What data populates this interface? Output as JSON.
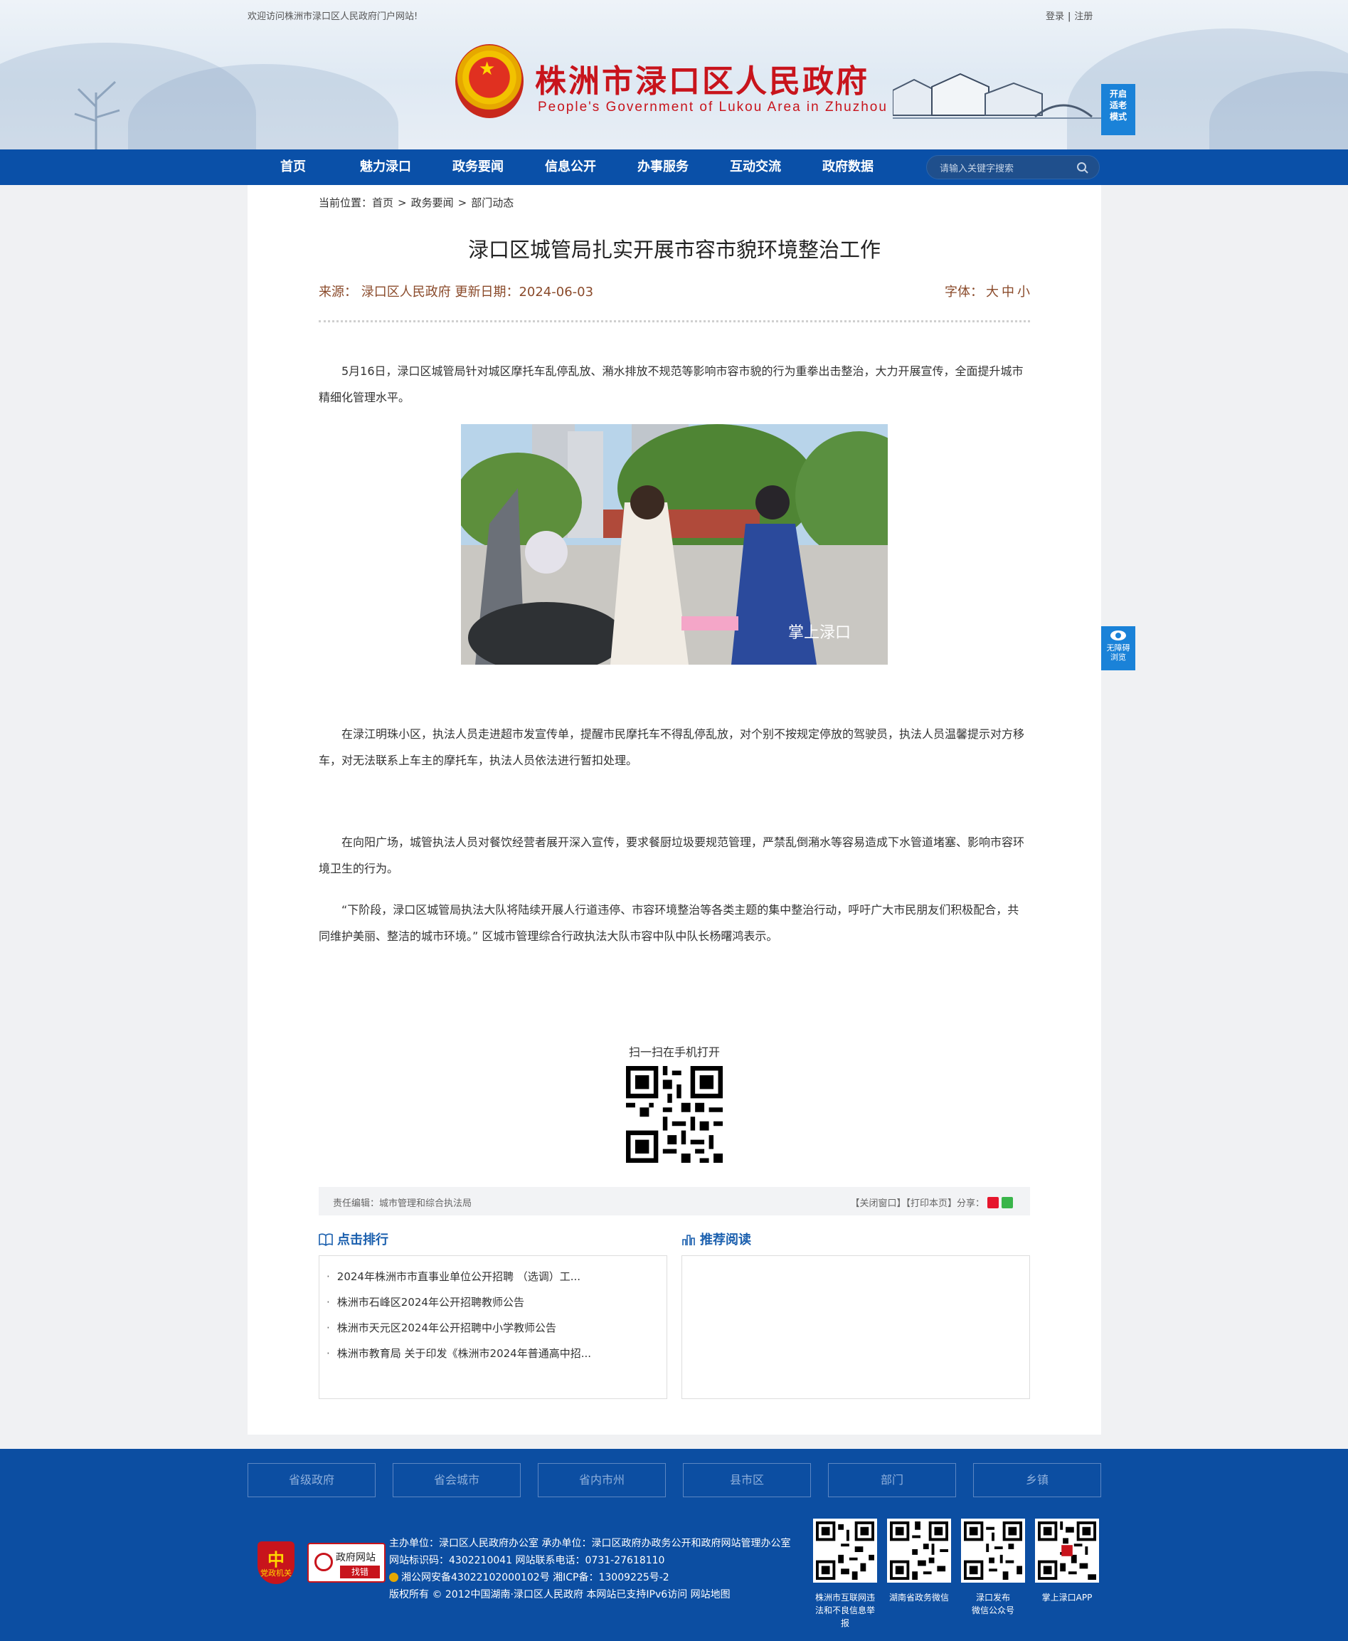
{
  "header": {
    "welcome": "欢迎访问株洲市渌口区人民政府门户网站!",
    "login": "登录",
    "separator": "|",
    "register": "注册",
    "site_title": "株洲市渌口区人民政府",
    "site_subtitle": "People's Government of Lukou Area in Zhuzhou",
    "elder_mode_lines": [
      "开启",
      "适老",
      "模式"
    ]
  },
  "nav": {
    "items": [
      "首页",
      "魅力渌口",
      "政务要闻",
      "信息公开",
      "办事服务",
      "互动交流",
      "政府数据"
    ],
    "search_placeholder": "请输入关键字搜索"
  },
  "breadcrumb": {
    "label": "当前位置：",
    "items": [
      "首页",
      "政务要闻",
      "部门动态"
    ],
    "sep": ">"
  },
  "article": {
    "title": "渌口区城管局扎实开展市容市貌环境整治工作",
    "meta": "来源：  渌口区人民政府 更新日期：2024-06-03",
    "font_label": "字体：",
    "font_sizes": [
      "大",
      "中",
      "小"
    ],
    "paragraphs": [
      "5月16日，渌口区城管局针对城区摩托车乱停乱放、潲水排放不规范等影响市容市貌的行为重拳出击整治，大力开展宣传，全面提升城市精细化管理水平。",
      "在渌江明珠小区，执法人员走进超市发宣传单，提醒市民摩托车不得乱停乱放，对个别不按规定停放的驾驶员，执法人员温馨提示对方移车，对无法联系上车主的摩托车，执法人员依法进行暂扣处理。",
      "在向阳广场，城管执法人员对餐饮经营者展开深入宣传，要求餐厨垃圾要规范管理，严禁乱倒潲水等容易造成下水管道堵塞、影响市容环境卫生的行为。",
      "“下阶段，渌口区城管局执法大队将陆续开展人行道违停、市容环境整治等各类主题的集中整治行动，呼吁广大市民朋友们积极配合，共同维护美丽、整洁的城市环境。” 区城市管理综合行政执法大队市容中队中队长杨曙鸿表示。"
    ],
    "photo_watermark": "掌上渌口",
    "qr_label": "扫一扫在手机打开"
  },
  "editor_bar": {
    "editor": "责任编辑：城市管理和综合执法局",
    "close": "【关闭窗口】",
    "print": "【打印本页】",
    "share": "分享："
  },
  "ranking": {
    "title": "点击排行",
    "items": [
      "2024年株洲市市直事业单位公开招聘 （选调）工...",
      "株洲市石峰区2024年公开招聘教师公告",
      "株洲市天元区2024年公开招聘中小学教师公告",
      "株洲市教育局 关于印发《株洲市2024年普通高中招..."
    ]
  },
  "recommend": {
    "title": "推荐阅读"
  },
  "footer": {
    "links": [
      "省级政府",
      "省会城市",
      "省内市州",
      "县市区",
      "部门",
      "乡镇"
    ],
    "badge_text": "党政机关",
    "jiucuo_line1": "政府网站",
    "jiucuo_line2": "找错",
    "info": [
      "主办单位：渌口区人民政府办公室  承办单位：渌口区政府办政务公开和政府网站管理办公室",
      "网站标识码：4302210041  网站联系电话：0731-27618110",
      "湘公网安备43022102000102号  湘ICP备：13009225号-2",
      "版权所有 © 2012中国湖南·渌口区人民政府 本网站已支持IPv6访问 网站地图"
    ],
    "qr_labels": [
      [
        "株洲市互联网违",
        "法和不良信息举",
        "报"
      ],
      [
        "湖南省政务微信"
      ],
      [
        "渌口发布",
        "微信公众号"
      ],
      [
        "掌上渌口APP"
      ]
    ]
  },
  "accessibility": {
    "lines": [
      "无障碍",
      "浏览"
    ]
  },
  "colors": {
    "nav_blue": "#0a50a8",
    "title_red": "#c8141c",
    "footer_blue": "#0c4ea2",
    "accent_blue": "#1a82d8"
  }
}
